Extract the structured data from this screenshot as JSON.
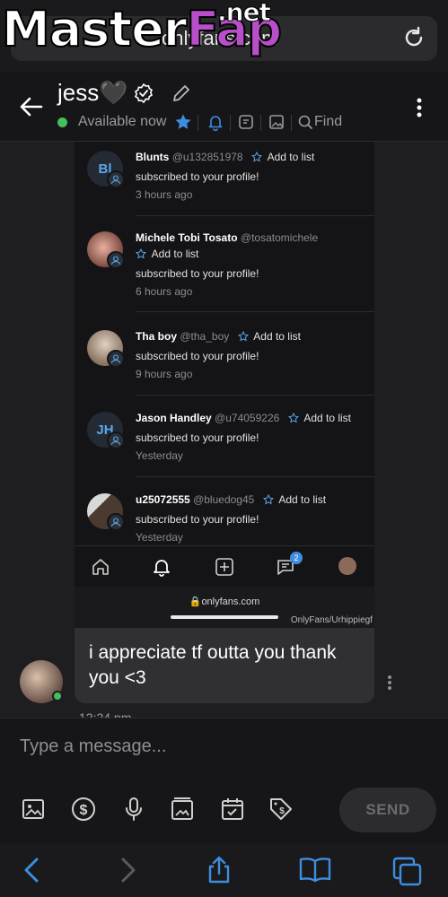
{
  "browser": {
    "url": "onlyfans.com",
    "watermark": {
      "part1": "Master",
      "part2": "Fap",
      "part3": ".net"
    }
  },
  "header": {
    "name": "jess🖤",
    "status": "Available now",
    "find_label": "Find"
  },
  "screenshot": {
    "notifications": [
      {
        "initials": "Bl",
        "name": "Blunts",
        "handle": "@u132851978",
        "add_label": "Add to list",
        "message": "subscribed to your profile!",
        "time": "3 hours ago"
      },
      {
        "initials": "",
        "name": "Michele Tobi Tosato",
        "handle": "@tosatomichele",
        "add_label": "Add to list",
        "message": "subscribed to your profile!",
        "time": "6 hours ago"
      },
      {
        "initials": "",
        "name": "Tha boy",
        "handle": "@tha_boy",
        "add_label": "Add to list",
        "message": "subscribed to your profile!",
        "time": "9 hours ago"
      },
      {
        "initials": "JH",
        "name": "Jason Handley",
        "handle": "@u74059226",
        "add_label": "Add to list",
        "message": "subscribed to your profile!",
        "time": "Yesterday"
      },
      {
        "initials": "",
        "name": "u25072555",
        "handle": "@bluedog45",
        "add_label": "Add to list",
        "message": "subscribed to your profile!",
        "time": "Yesterday"
      }
    ],
    "nav_badge": "2",
    "domain": "onlyfans.com",
    "watermark": "OnlyFans/Urhippiegf"
  },
  "message": {
    "text": "i appreciate tf outta you thank you <3",
    "time": "12:24 pm"
  },
  "compose": {
    "placeholder": "Type a message...",
    "send_label": "SEND"
  },
  "colors": {
    "accent": "#3d8ee0",
    "online": "#43c05b",
    "watermark_fap": "#b84ec9"
  }
}
